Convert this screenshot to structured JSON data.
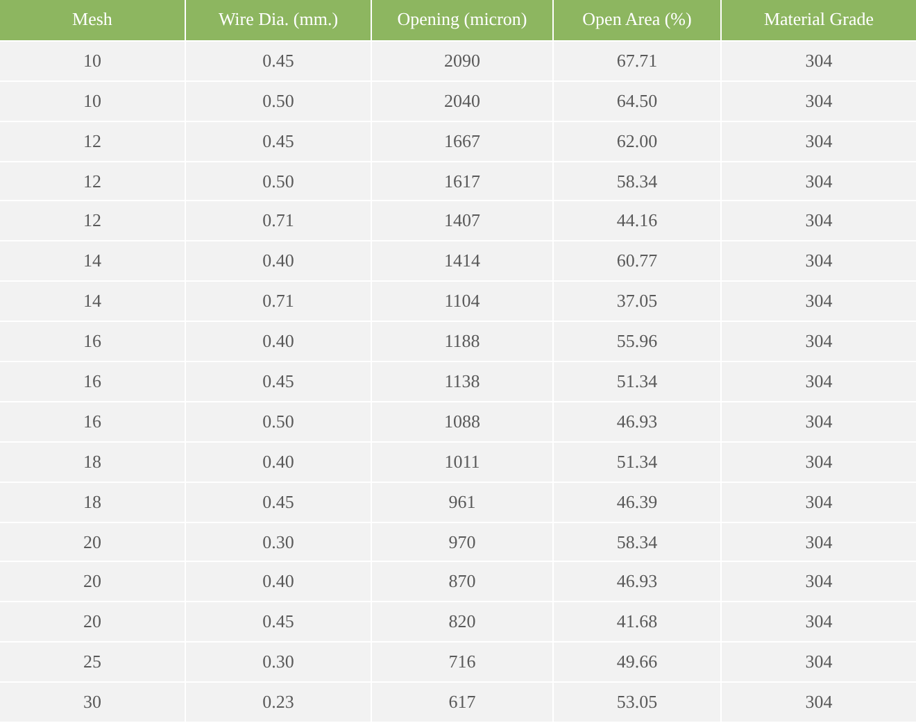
{
  "table": {
    "columns": [
      "Mesh",
      "Wire Dia. (mm.)",
      "Opening (micron)",
      "Open Area (%)",
      "Material Grade"
    ],
    "rows": [
      [
        "10",
        "0.45",
        "2090",
        "67.71",
        "304"
      ],
      [
        "10",
        "0.50",
        "2040",
        "64.50",
        "304"
      ],
      [
        "12",
        "0.45",
        "1667",
        "62.00",
        "304"
      ],
      [
        "12",
        "0.50",
        "1617",
        "58.34",
        "304"
      ],
      [
        "12",
        "0.71",
        "1407",
        "44.16",
        "304"
      ],
      [
        "14",
        "0.40",
        "1414",
        "60.77",
        "304"
      ],
      [
        "14",
        "0.71",
        "1104",
        "37.05",
        "304"
      ],
      [
        "16",
        "0.40",
        "1188",
        "55.96",
        "304"
      ],
      [
        "16",
        "0.45",
        "1138",
        "51.34",
        "304"
      ],
      [
        "16",
        "0.50",
        "1088",
        "46.93",
        "304"
      ],
      [
        "18",
        "0.40",
        "1011",
        "51.34",
        "304"
      ],
      [
        "18",
        "0.45",
        "961",
        "46.39",
        "304"
      ],
      [
        "20",
        "0.30",
        "970",
        "58.34",
        "304"
      ],
      [
        "20",
        "0.40",
        "870",
        "46.93",
        "304"
      ],
      [
        "20",
        "0.45",
        "820",
        "41.68",
        "304"
      ],
      [
        "25",
        "0.30",
        "716",
        "49.66",
        "304"
      ],
      [
        "30",
        "0.23",
        "617",
        "53.05",
        "304"
      ]
    ]
  }
}
